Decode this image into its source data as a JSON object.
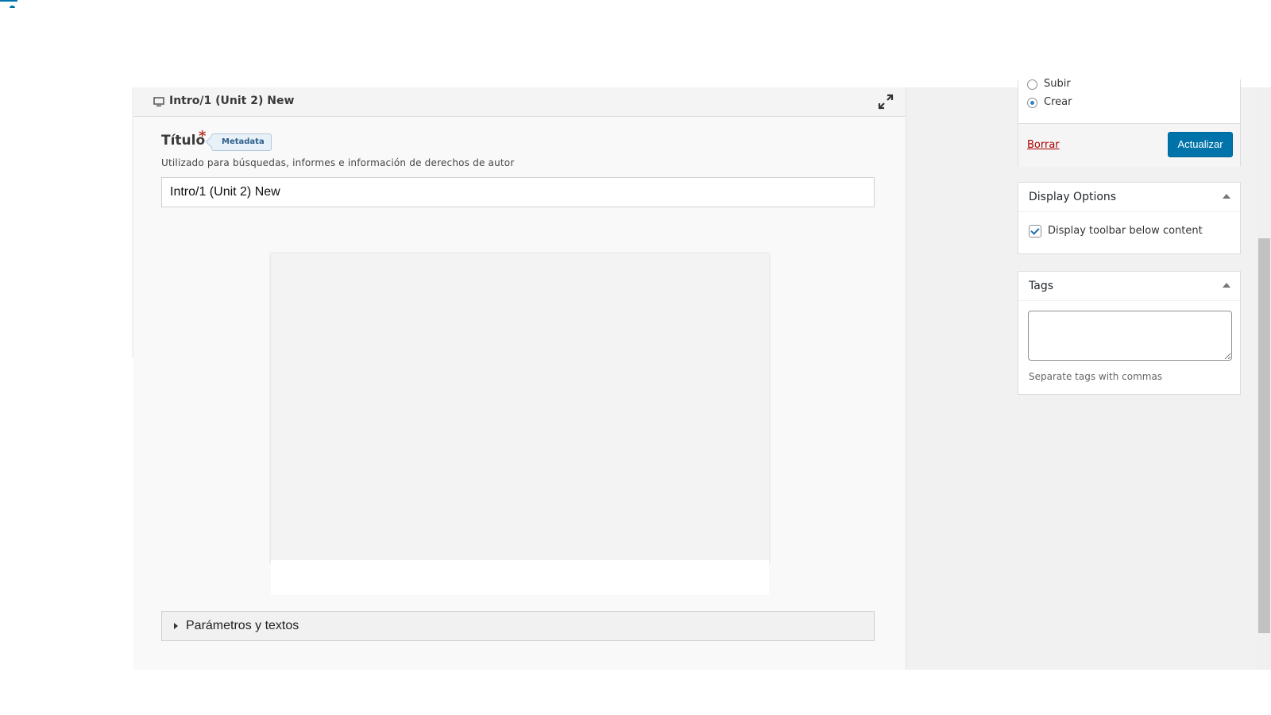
{
  "editor": {
    "header_title": "Intro/1 (Unit 2) New",
    "title_label": "Título",
    "required_mark": "*",
    "metadata_badge": "Metadata",
    "title_description": "Utilizado para búsquedas, informes e información de derechos de autor",
    "title_value": "Intro/1 (Unit 2) New",
    "params_label": "Parámetros y textos"
  },
  "publish": {
    "options": [
      {
        "label": "Subir",
        "selected": false
      },
      {
        "label": "Crear",
        "selected": true
      }
    ],
    "delete_label": "Borrar",
    "update_label": "Actualizar"
  },
  "display_options": {
    "title": "Display Options",
    "checkbox_label": "Display toolbar below content",
    "checked": true
  },
  "tags": {
    "title": "Tags",
    "value": "",
    "help": "Separate tags with commas"
  },
  "colors": {
    "primary_button": "#0073aa",
    "delete_link": "#aa0000",
    "required": "#c0392b"
  }
}
